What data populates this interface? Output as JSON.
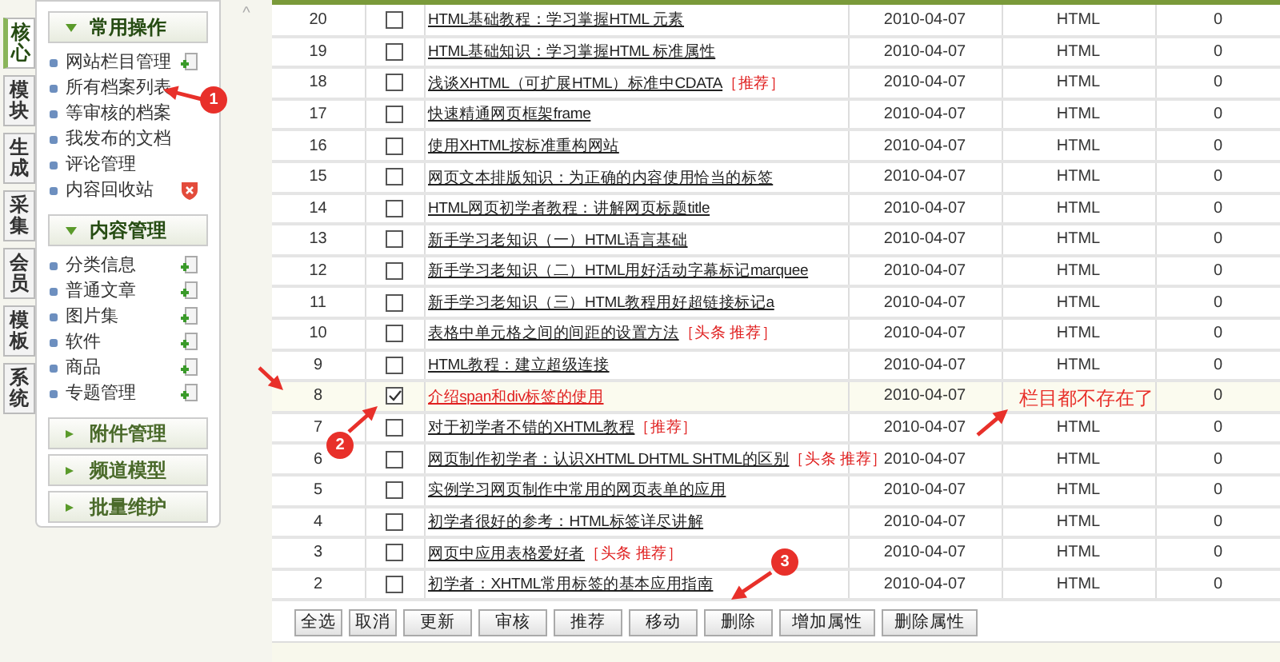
{
  "side_tabs": [
    {
      "label": "核心",
      "selected": true
    },
    {
      "label": "模块",
      "selected": false
    },
    {
      "label": "生成",
      "selected": false
    },
    {
      "label": "采集",
      "selected": false
    },
    {
      "label": "会员",
      "selected": false
    },
    {
      "label": "模板",
      "selected": false
    },
    {
      "label": "系统",
      "selected": false
    }
  ],
  "menu": [
    {
      "title": "常用操作",
      "expanded": true,
      "items": [
        {
          "label": "网站栏目管理",
          "kind": "add"
        },
        {
          "label": "所有档案列表",
          "kind": "plain"
        },
        {
          "label": "等审核的档案",
          "kind": "plain"
        },
        {
          "label": "我发布的文档",
          "kind": "plain"
        },
        {
          "label": "评论管理",
          "kind": "plain"
        },
        {
          "label": "内容回收站",
          "kind": "delete"
        }
      ]
    },
    {
      "title": "内容管理",
      "expanded": true,
      "items": [
        {
          "label": "分类信息",
          "kind": "add"
        },
        {
          "label": "普通文章",
          "kind": "add"
        },
        {
          "label": "图片集",
          "kind": "add"
        },
        {
          "label": "软件",
          "kind": "add"
        },
        {
          "label": "商品",
          "kind": "add"
        },
        {
          "label": "专题管理",
          "kind": "add"
        }
      ]
    },
    {
      "title": "附件管理",
      "expanded": false
    },
    {
      "title": "频道模型",
      "expanded": false
    },
    {
      "title": "批量维护",
      "expanded": false
    }
  ],
  "scroll_up": "^",
  "rows": [
    {
      "id": "20",
      "checked": false,
      "title": "HTML基础教程：学习掌握HTML 元素",
      "date": "2010-04-07",
      "type": "HTML",
      "count": "0"
    },
    {
      "id": "19",
      "checked": false,
      "title": "HTML基础知识：学习掌握HTML 标准属性",
      "date": "2010-04-07",
      "type": "HTML",
      "count": "0"
    },
    {
      "id": "18",
      "checked": false,
      "title": "浅谈XHTML（可扩展HTML）标准中CDATA",
      "tag": "［推荐］",
      "date": "2010-04-07",
      "type": "HTML",
      "count": "0"
    },
    {
      "id": "17",
      "checked": false,
      "title": "快速精通网页框架frame",
      "date": "2010-04-07",
      "type": "HTML",
      "count": "0"
    },
    {
      "id": "16",
      "checked": false,
      "title": "使用XHTML按标准重构网站",
      "date": "2010-04-07",
      "type": "HTML",
      "count": "0"
    },
    {
      "id": "15",
      "checked": false,
      "title": "网页文本排版知识：为正确的内容使用恰当的标签",
      "date": "2010-04-07",
      "type": "HTML",
      "count": "0"
    },
    {
      "id": "14",
      "checked": false,
      "title": "HTML网页初学者教程：讲解网页标题title",
      "date": "2010-04-07",
      "type": "HTML",
      "count": "0"
    },
    {
      "id": "13",
      "checked": false,
      "title": "新手学习老知识（一）HTML语言基础",
      "date": "2010-04-07",
      "type": "HTML",
      "count": "0"
    },
    {
      "id": "12",
      "checked": false,
      "title": "新手学习老知识（二）HTML用好活动字幕标记marquee",
      "date": "2010-04-07",
      "type": "HTML",
      "count": "0"
    },
    {
      "id": "11",
      "checked": false,
      "title": "新手学习老知识（三）HTML教程用好超链接标记a",
      "date": "2010-04-07",
      "type": "HTML",
      "count": "0"
    },
    {
      "id": "10",
      "checked": false,
      "title": "表格中单元格之间的间距的设置方法",
      "tag": "［头条 推荐］",
      "date": "2010-04-07",
      "type": "HTML",
      "count": "0"
    },
    {
      "id": "9",
      "checked": false,
      "title": "HTML教程：建立超级连接",
      "date": "2010-04-07",
      "type": "HTML",
      "count": "0"
    },
    {
      "id": "8",
      "checked": true,
      "title": "介绍span和div标签的使用",
      "date": "2010-04-07",
      "count": "0"
    },
    {
      "id": "7",
      "checked": false,
      "title": "对于初学者不错的XHTML教程",
      "tag": "［推荐］",
      "date": "2010-04-07",
      "type": "HTML",
      "count": "0"
    },
    {
      "id": "6",
      "checked": false,
      "title": "网页制作初学者：认识XHTML DHTML SHTML的区别",
      "tag": "［头条 推荐］",
      "date": "2010-04-07",
      "type": "HTML",
      "count": "0"
    },
    {
      "id": "5",
      "checked": false,
      "title": "实例学习网页制作中常用的网页表单的应用",
      "date": "2010-04-07",
      "type": "HTML",
      "count": "0"
    },
    {
      "id": "4",
      "checked": false,
      "title": "初学者很好的参考：HTML标签详尽讲解",
      "date": "2010-04-07",
      "type": "HTML",
      "count": "0"
    },
    {
      "id": "3",
      "checked": false,
      "title": "网页中应用表格爱好者",
      "tag": "［头条 推荐］",
      "date": "2010-04-07",
      "type": "HTML",
      "count": "0"
    },
    {
      "id": "2",
      "checked": false,
      "title": "初学者：XHTML常用标签的基本应用指南",
      "date": "2010-04-07",
      "type": "HTML",
      "count": "0"
    }
  ],
  "buttons": [
    "全选",
    "取消",
    "更新",
    "审核",
    "推荐",
    "移动",
    "删除",
    "增加属性",
    "删除属性"
  ],
  "annotations": {
    "markers": [
      "1",
      "2",
      "3"
    ],
    "note": "栏目都不存在了"
  }
}
